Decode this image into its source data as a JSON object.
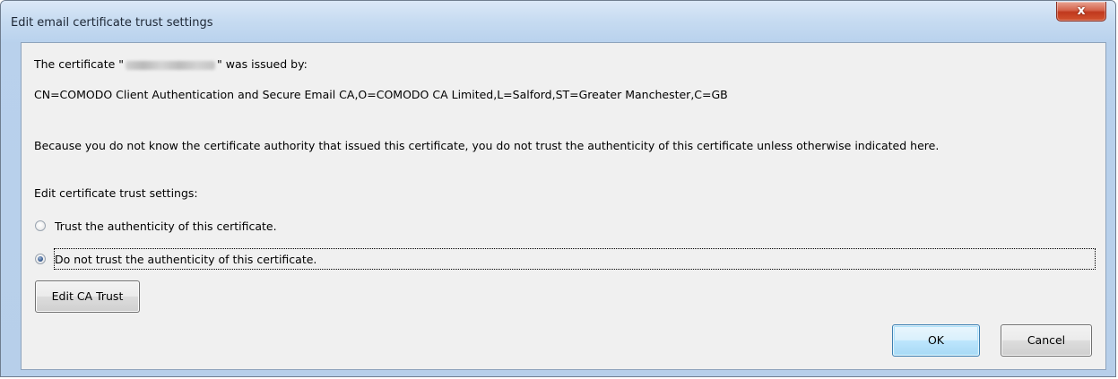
{
  "window": {
    "title": "Edit email certificate trust settings",
    "close_glyph": "x"
  },
  "body": {
    "issued_prefix": "The certificate \"",
    "issued_suffix": "\" was issued by:",
    "issuer_dn": "CN=COMODO Client Authentication and Secure Email CA,O=COMODO CA Limited,L=Salford,ST=Greater Manchester,C=GB",
    "explanation": "Because you do not know the certificate authority that issued this certificate, you do not trust the authenticity of this certificate unless otherwise indicated here.",
    "section_label": "Edit certificate trust settings:"
  },
  "options": {
    "trust_label": "Trust the authenticity of this certificate.",
    "distrust_label": "Do not trust the authenticity of this certificate.",
    "selected": "distrust"
  },
  "buttons": {
    "edit_ca_trust": "Edit CA Trust",
    "ok": "OK",
    "cancel": "Cancel"
  },
  "colors": {
    "title_bar": "#c6dbf1",
    "dialog_background": "#f0f0f0",
    "close_button": "#c8432a",
    "default_button_border": "#3c7fb1"
  },
  "icons": {
    "close": "close-icon",
    "radio_unchecked": "radio-unchecked-icon",
    "radio_checked": "radio-checked-icon"
  }
}
